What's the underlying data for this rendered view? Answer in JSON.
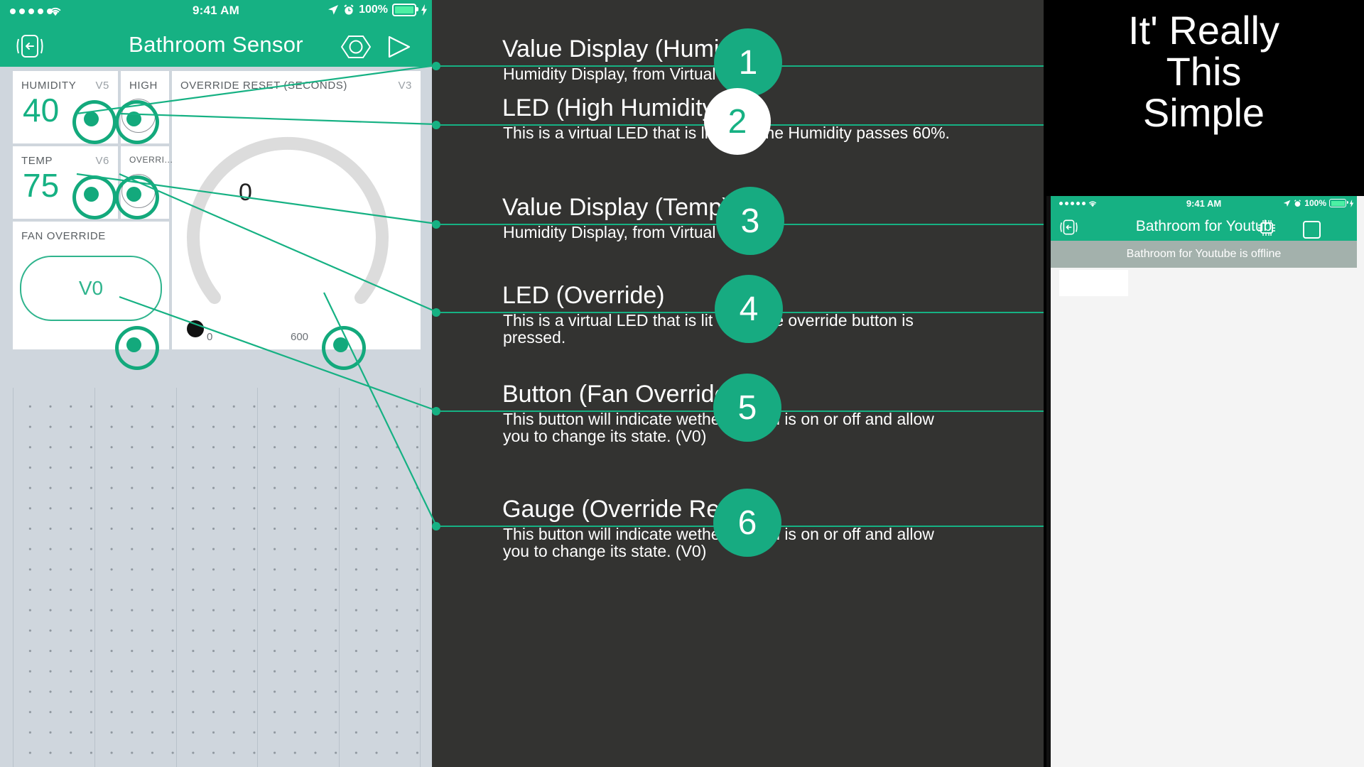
{
  "left_app": {
    "status_bar": {
      "time": "9:41 AM",
      "battery": "100%",
      "signal_icon": "signal-dots-icon",
      "wifi_icon": "wifi-icon",
      "location_icon": "location-arrow-icon",
      "alarm_icon": "alarm-clock-icon",
      "battery_icon": "battery-icon"
    },
    "nav": {
      "title": "Bathroom Sensor",
      "back_icon": "back-arrow-icon",
      "hardware_icon": "hexagon-icon",
      "play_icon": "play-triangle-icon"
    },
    "widgets": {
      "humidity": {
        "label": "HUMIDITY",
        "pin": "V5",
        "value": "40"
      },
      "high_led": {
        "label": "HIGH"
      },
      "temp": {
        "label": "TEMP",
        "pin": "V6",
        "value": "75"
      },
      "override_led": {
        "label": "OVERRI..."
      },
      "fan_override": {
        "label": "FAN OVERRIDE",
        "button_label": "V0"
      },
      "gauge": {
        "label": "OVERRIDE RESET (SECONDS)",
        "pin": "V3",
        "value": "0",
        "min": "0",
        "max": "600"
      }
    }
  },
  "annotations": [
    {
      "number": "1",
      "title": "Value Display (Humidity)",
      "text": "Humidity Display, from Virtual Pin V5",
      "badge_style": "green"
    },
    {
      "number": "2",
      "title": "LED (High Humidity)",
      "text": "This is a virtual LED that is lit when the Humidity passes 60%.",
      "badge_style": "white"
    },
    {
      "number": "3",
      "title": "Value Display (Temp)",
      "text": "Humidity Display, from Virtual Pin V6",
      "badge_style": "green"
    },
    {
      "number": "4",
      "title": "LED (Override)",
      "text": "This is a virtual LED that is lit when the override button is pressed.",
      "badge_style": "green"
    },
    {
      "number": "5",
      "title": "Button (Fan Override)",
      "text": "This button will indicate wether the fan is on or off and allow you to change its state. (V0)",
      "badge_style": "green"
    },
    {
      "number": "6",
      "title": "Gauge (Override Reset)",
      "text": "This button will indicate wether the fan is on or off and allow you to change its state. (V0)",
      "badge_style": "green"
    }
  ],
  "right_panel": {
    "slogan_line1": "It' Really",
    "slogan_line2": "This",
    "slogan_line3": "Simple",
    "phone": {
      "status_bar": {
        "time": "9:41 AM",
        "battery": "100%"
      },
      "nav": {
        "title": "Bathroom for Youtub",
        "back_icon": "back-arrow-icon",
        "chip_icon": "microchip-icon",
        "square_icon": "square-icon"
      },
      "offline_banner": "Bathroom for Youtube is offline"
    }
  },
  "colors": {
    "accent": "#16b183",
    "accent_dark": "#13a97c",
    "panel_bg": "#333331",
    "canvas_bg": "#cfd6dd",
    "offline_gray": "#a3b1ac"
  }
}
